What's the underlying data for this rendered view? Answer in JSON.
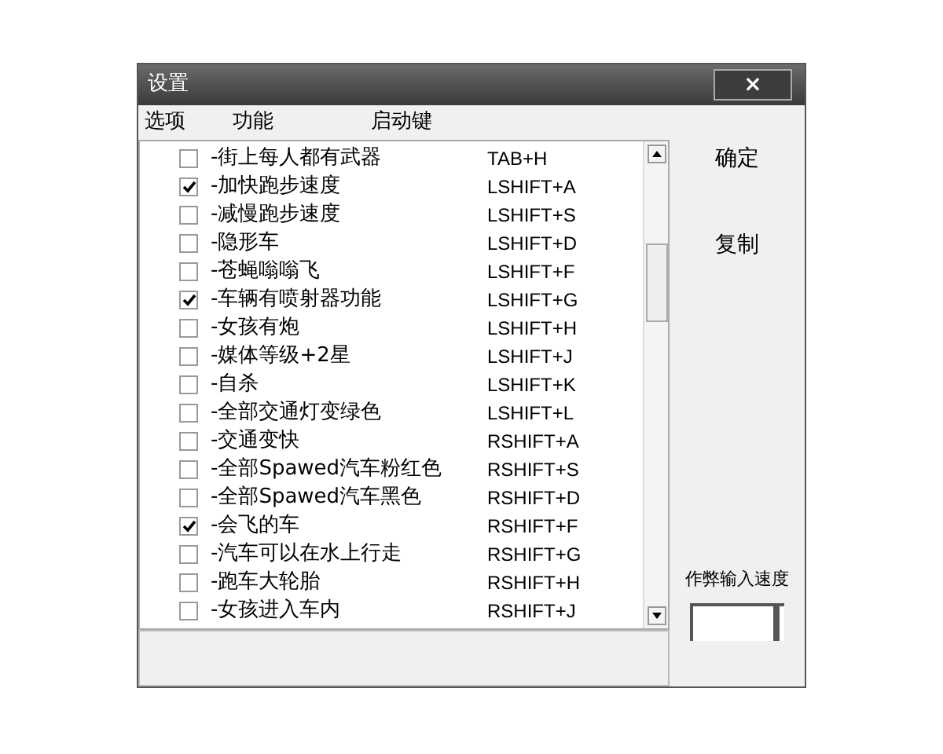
{
  "window": {
    "title": "设置",
    "close": "×"
  },
  "columns": [
    "选项",
    "功能",
    "启动键"
  ],
  "rows": [
    {
      "checked": false,
      "name": "-街上每人都有武器",
      "key": "TAB+H"
    },
    {
      "checked": true,
      "name": "-加快跑步速度",
      "key": "LSHIFT+A"
    },
    {
      "checked": false,
      "name": "-减慢跑步速度",
      "key": "LSHIFT+S"
    },
    {
      "checked": false,
      "name": "-隐形车",
      "key": "LSHIFT+D"
    },
    {
      "checked": false,
      "name": "-苍蝇嗡嗡飞",
      "key": "LSHIFT+F"
    },
    {
      "checked": true,
      "name": "-车辆有喷射器功能",
      "key": "LSHIFT+G"
    },
    {
      "checked": false,
      "name": "-女孩有炮",
      "key": "LSHIFT+H"
    },
    {
      "checked": false,
      "name": "-媒体等级+2星",
      "key": "LSHIFT+J"
    },
    {
      "checked": false,
      "name": "-自杀",
      "key": "LSHIFT+K"
    },
    {
      "checked": false,
      "name": "-全部交通灯变绿色",
      "key": "LSHIFT+L"
    },
    {
      "checked": false,
      "name": "-交通变快",
      "key": "RSHIFT+A"
    },
    {
      "checked": false,
      "name": "-全部Spawed汽车粉红色",
      "key": "RSHIFT+S"
    },
    {
      "checked": false,
      "name": "-全部Spawed汽车黑色",
      "key": "RSHIFT+D"
    },
    {
      "checked": true,
      "name": "-会飞的车",
      "key": "RSHIFT+F"
    },
    {
      "checked": false,
      "name": "-汽车可以在水上行走",
      "key": "RSHIFT+G"
    },
    {
      "checked": false,
      "name": "-跑车大轮胎",
      "key": "RSHIFT+H"
    },
    {
      "checked": false,
      "name": "-女孩进入车内",
      "key": "RSHIFT+J"
    }
  ],
  "buttons": [
    "确定",
    "复制"
  ],
  "speed": {
    "label": "作弊输入速度",
    "level": 0.95
  }
}
